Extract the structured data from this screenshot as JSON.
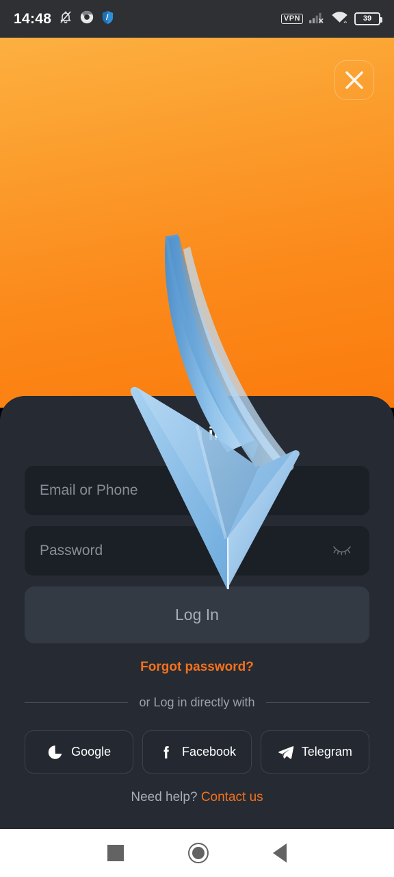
{
  "status_bar": {
    "time": "14:48",
    "left_icons": [
      "bell-muted-icon",
      "chrome-icon",
      "shield-vpn-icon"
    ],
    "vpn_label": "VPN",
    "right_icons": [
      "signal-no-service-icon",
      "wifi-icon"
    ],
    "battery_level": "39"
  },
  "hero": {
    "close_label": "close-icon",
    "gradient_from": "#FCB040",
    "gradient_to": "#FB7B0D"
  },
  "card": {
    "title": "Log in",
    "fields": [
      {
        "name": "email-or-phone",
        "placeholder": "Email or Phone",
        "value": ""
      },
      {
        "name": "password",
        "placeholder": "Password",
        "value": ""
      }
    ],
    "password_toggle": "eye-closed-icon",
    "login_button": "Log In",
    "forgot_password": "Forgot password?",
    "divider_text": "or Log in directly with",
    "social_buttons": [
      {
        "label": "Google",
        "icon": "google-icon"
      },
      {
        "label": "Facebook",
        "icon": "facebook-icon"
      },
      {
        "label": "Telegram",
        "icon": "telegram-icon"
      }
    ],
    "footer_prefix": "Need help?",
    "footer_link": "Contact us"
  },
  "overlay": {
    "annotation": "blue-down-arrow-icon"
  },
  "nav_bar": {
    "recents": "recents-square-icon",
    "home": "home-circle-icon",
    "back": "back-triangle-icon"
  },
  "colors": {
    "accent_orange": "#F4711C",
    "card_bg": "#262B33",
    "field_bg": "#1B2027",
    "arrow_blue": "#7FB6E4"
  }
}
